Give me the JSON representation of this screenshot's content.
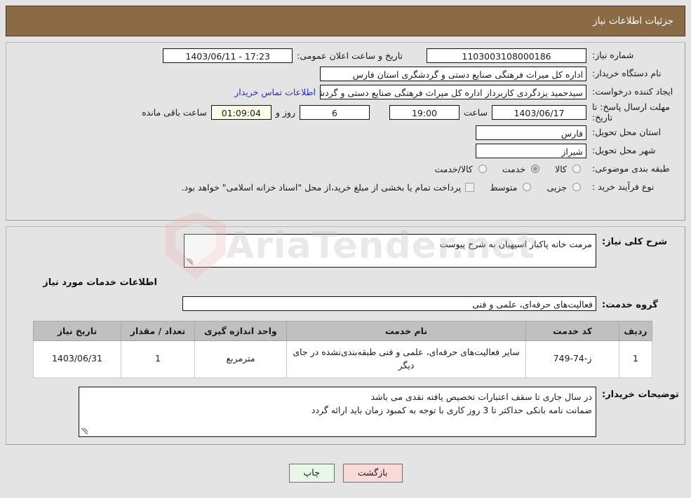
{
  "header": {
    "title": "جزئیات اطلاعات نیاز"
  },
  "info": {
    "need_number_label": "شماره نیاز:",
    "need_number": "1103003108000186",
    "public_announce_label": "تاریخ و ساعت اعلان عمومی:",
    "public_announce_value": "1403/06/11 - 17:23",
    "buyer_org_label": "نام دستگاه خریدار:",
    "buyer_org": "اداره کل میراث فرهنگی  صنایع دستی و گردشگری استان فارس",
    "creator_label": "ایجاد کننده درخواست:",
    "creator": "سیدحمید یزدگردی کاربرداز اداره کل میراث فرهنگی  صنایع دستی و گردشگری ا",
    "contact_link": "اطلاعات تماس خریدار",
    "deadline_label": "مهلت ارسال پاسخ: تا تاریخ:",
    "deadline_date": "1403/06/17",
    "hour_word": "ساعت",
    "deadline_time": "19:00",
    "days_remaining": "6",
    "days_word": "روز و",
    "countdown": "01:09:04",
    "remaining_suffix": "ساعت باقی مانده",
    "province_label": "استان محل تحویل:",
    "province": "فارس",
    "city_label": "شهر محل تحویل:",
    "city": "شیراز",
    "category_label": "طبقه بندی موضوعی:",
    "category_options": [
      {
        "label": "کالا",
        "selected": false
      },
      {
        "label": "خدمت",
        "selected": true
      },
      {
        "label": "کالا/خدمت",
        "selected": false
      }
    ],
    "process_label": "نوع فرآیند خرید :",
    "process_options": [
      {
        "label": "جزیی",
        "selected": false
      },
      {
        "label": "متوسط",
        "selected": false
      }
    ],
    "treasury_note": "پرداخت تمام یا بخشی از مبلغ خرید،از محل \"اسناد خزانه اسلامی\" خواهد بود.",
    "treasury_checked": false
  },
  "description": {
    "summary_label": "شرح کلی نیاز:",
    "summary_text": "مرمت خانه پاکباز اسپهبان به شرح پیوست",
    "services_section_title": "اطلاعات خدمات مورد نیاز",
    "service_group_label": "گروه خدمت:",
    "service_group": "فعالیت‌های حرفه‌ای، علمی و فنی"
  },
  "table": {
    "columns": [
      "ردیف",
      "کد خدمت",
      "نام خدمت",
      "واحد اندازه گیری",
      "تعداد / مقدار",
      "تاریخ نیاز"
    ],
    "rows": [
      {
        "radif": "1",
        "code": "ز-74-749",
        "name": "سایر فعالیت‌های حرفه‌ای، علمی و فنی طبقه‌بندی‌نشده در جای دیگر",
        "unit": "مترمربع",
        "quantity": "1",
        "need_date": "1403/06/31"
      }
    ]
  },
  "notes": {
    "label": "توضیحات خریدار:",
    "text": "در سال جاری تا سقف اعتبارات تخصیص یافته نقدی می باشد\nضمانت نامه بانکی حداکثر تا 3 روز کاری با توجه به کمبود زمان باید ارائه گردد"
  },
  "footer": {
    "print_label": "چاپ",
    "back_label": "بازگشت"
  },
  "watermark": {
    "text": "AriaTender.net"
  },
  "colors": {
    "header_bg": "#8b6b45",
    "page_bg": "#e4e4e4",
    "link": "#2b2bcf",
    "print_btn": "#e7f6e7",
    "back_btn": "#fbd9d9",
    "countdown_bg": "#fbfbe8",
    "table_header_bg": "#c0c0c0"
  }
}
